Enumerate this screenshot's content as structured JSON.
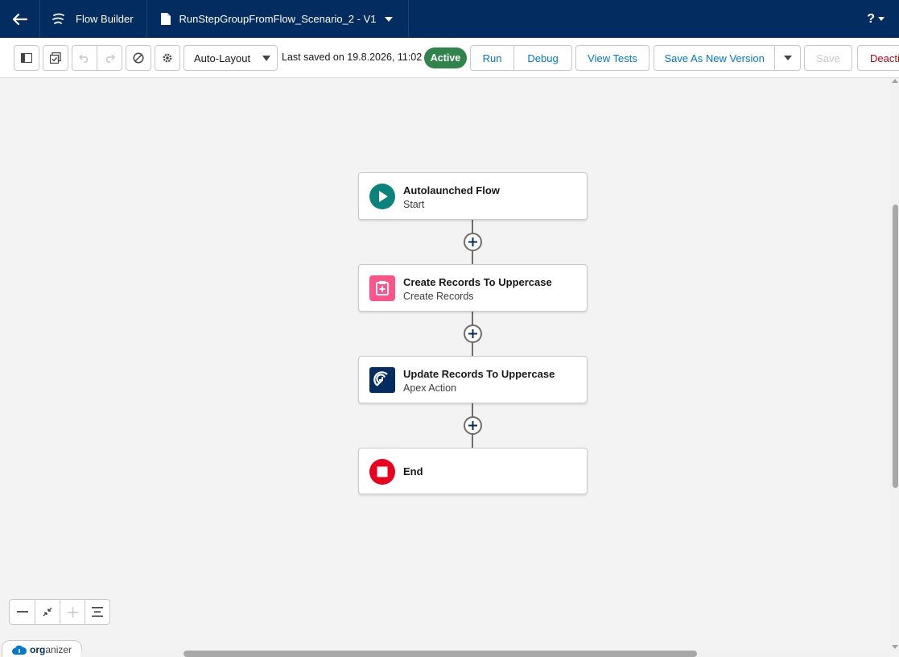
{
  "header": {
    "app_name": "Flow Builder",
    "flow_name": "RunStepGroupFromFlow_Scenario_2 - V1",
    "help_label": "?"
  },
  "toolbar": {
    "layout_select": "Auto-Layout",
    "last_saved": "Last saved on 19.8.2026, 11:02",
    "status_badge": "Active",
    "run_label": "Run",
    "debug_label": "Debug",
    "view_tests_label": "View Tests",
    "save_as_new_version_label": "Save As New Version",
    "save_label": "Save",
    "deactivate_label": "Deacti"
  },
  "nodes": [
    {
      "title": "Autolaunched Flow",
      "subtitle": "Start",
      "icon": "play-icon",
      "color": "#0b827c"
    },
    {
      "title": "Create Records To Uppercase",
      "subtitle": "Create Records",
      "icon": "create-record-icon",
      "color": "#ff538a"
    },
    {
      "title": "Update Records To Uppercase",
      "subtitle": "Apex Action",
      "icon": "apex-action-icon",
      "color": "#032d60"
    },
    {
      "title": "End",
      "subtitle": "",
      "icon": "stop-icon",
      "color": "#ea001e"
    }
  ],
  "organizer": {
    "prefix": "org",
    "suffix": "anizer"
  },
  "colors": {
    "header_bg": "#032d60",
    "accent": "#0176d3",
    "active_badge": "#2e844a",
    "canvas_bg": "#f3f3f3"
  }
}
